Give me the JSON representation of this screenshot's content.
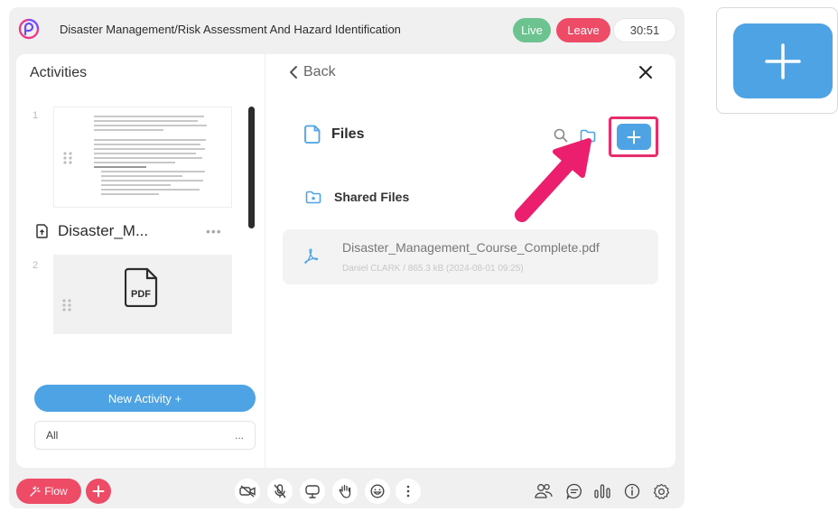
{
  "header": {
    "course_title": "Disaster Management/Risk Assessment And Hazard Identification",
    "live_label": "Live",
    "leave_label": "Leave",
    "timer": "30:51"
  },
  "activities": {
    "title": "Activities",
    "slides": [
      {
        "number": "1",
        "file_name": "Disaster_M...",
        "menu": "•••"
      },
      {
        "number": "2"
      }
    ],
    "new_activity_label": "New Activity +",
    "filter": {
      "value": "All",
      "more": "..."
    }
  },
  "files_panel": {
    "back_label": "Back",
    "files_label": "Files",
    "shared_files_label": "Shared Files",
    "items": [
      {
        "name": "Disaster_Management_Course_Complete.pdf",
        "meta": "Daniel CLARK  /  865.3 kB (2024-08-01 09:25)"
      }
    ]
  },
  "bottom_bar": {
    "flow_label": "Flow"
  },
  "colors": {
    "accent_blue": "#4da3e4",
    "brand_red": "#ee4b67",
    "live_green": "#6cc38f",
    "highlight_pink": "#e62e6b"
  },
  "icons": [
    "app-logo-icon",
    "drag-handle-icon",
    "file-upload-icon",
    "pdf-icon",
    "chevron-left-icon",
    "close-icon",
    "file-icon",
    "search-icon",
    "folder-icon",
    "plus-icon",
    "shared-folder-icon",
    "acrobat-icon",
    "video-off-icon",
    "mic-off-icon",
    "screen-share-icon",
    "raise-hand-icon",
    "emoji-icon",
    "more-vertical-icon",
    "participants-icon",
    "chat-icon",
    "poll-icon",
    "info-icon",
    "settings-icon",
    "magic-icon"
  ]
}
